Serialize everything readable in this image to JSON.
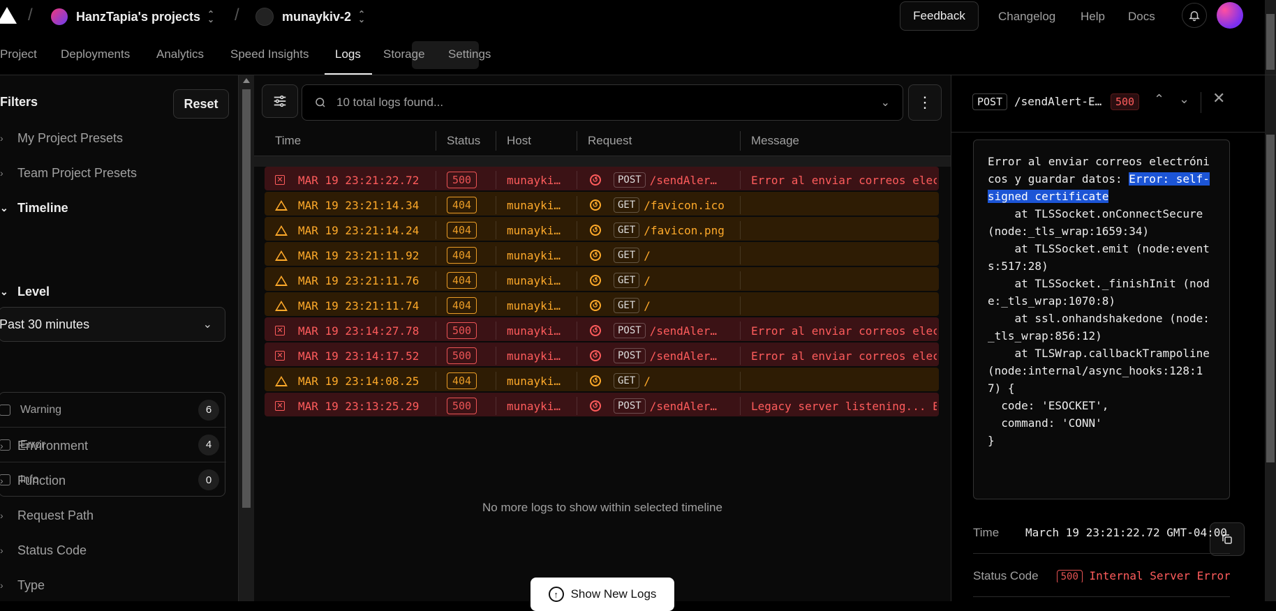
{
  "topbar": {
    "team": "HanzTapia's projects",
    "project": "munaykiv-2",
    "feedback": "Feedback",
    "changelog": "Changelog",
    "help": "Help",
    "docs": "Docs"
  },
  "tabs": [
    "Project",
    "Deployments",
    "Analytics",
    "Speed Insights",
    "Logs",
    "Storage",
    "Settings"
  ],
  "sidebar": {
    "title": "Filters",
    "reset": "Reset",
    "my_presets": "My Project Presets",
    "team_presets": "Team Project Presets",
    "timeline": "Timeline",
    "timeline_value": "Past 30 minutes",
    "level": "Level",
    "levels": [
      {
        "label": "Warning",
        "count": "6"
      },
      {
        "label": "Error",
        "count": "4"
      },
      {
        "label": "Info",
        "count": "0"
      }
    ],
    "environment": "Environment",
    "function": "Function",
    "request_path": "Request Path",
    "status_code": "Status Code",
    "type": "Type"
  },
  "search": {
    "placeholder": "10 total logs found..."
  },
  "table": {
    "headers": {
      "time": "Time",
      "status": "Status",
      "host": "Host",
      "request": "Request",
      "message": "Message"
    },
    "rows": [
      {
        "kind": "error",
        "time": "MAR 19 23:21:22.72",
        "status": "500",
        "host": "munayki…",
        "method": "POST",
        "path": "/sendAler…",
        "message": "Error al enviar correos elec"
      },
      {
        "kind": "warning",
        "time": "MAR 19 23:21:14.34",
        "status": "404",
        "host": "munayki…",
        "method": "GET",
        "path": "/favicon.ico",
        "message": ""
      },
      {
        "kind": "warning",
        "time": "MAR 19 23:21:14.24",
        "status": "404",
        "host": "munayki…",
        "method": "GET",
        "path": "/favicon.png",
        "message": ""
      },
      {
        "kind": "warning",
        "time": "MAR 19 23:21:11.92",
        "status": "404",
        "host": "munayki…",
        "method": "GET",
        "path": "/",
        "message": ""
      },
      {
        "kind": "warning",
        "time": "MAR 19 23:21:11.76",
        "status": "404",
        "host": "munayki…",
        "method": "GET",
        "path": "/",
        "message": ""
      },
      {
        "kind": "warning",
        "time": "MAR 19 23:21:11.74",
        "status": "404",
        "host": "munayki…",
        "method": "GET",
        "path": "/",
        "message": ""
      },
      {
        "kind": "error",
        "time": "MAR 19 23:14:27.78",
        "status": "500",
        "host": "munayki…",
        "method": "POST",
        "path": "/sendAler…",
        "message": "Error al enviar correos elec"
      },
      {
        "kind": "error",
        "time": "MAR 19 23:14:17.52",
        "status": "500",
        "host": "munayki…",
        "method": "POST",
        "path": "/sendAler…",
        "message": "Error al enviar correos elec"
      },
      {
        "kind": "warning",
        "time": "MAR 19 23:14:08.25",
        "status": "404",
        "host": "munayki…",
        "method": "GET",
        "path": "/",
        "message": ""
      },
      {
        "kind": "error",
        "time": "MAR 19 23:13:25.29",
        "status": "500",
        "host": "munayki…",
        "method": "POST",
        "path": "/sendAler…",
        "message": "Legacy server listening... E"
      }
    ],
    "empty": "No more logs to show within selected timeline",
    "show_new": "Show New Logs"
  },
  "detail": {
    "method": "POST",
    "path": "/sendAlert-E…",
    "status": "500",
    "message_pre": "Error al enviar correos electrónicos y guardar datos: ",
    "message_highlight": "Error: self-signed certificate",
    "message_post": "\n    at TLSSocket.onConnectSecure (node:_tls_wrap:1659:34)\n    at TLSSocket.emit (node:events:517:28)\n    at TLSSocket._finishInit (node:_tls_wrap:1070:8)\n    at ssl.onhandshakedone (node:_tls_wrap:856:12)\n    at TLSWrap.callbackTrampoline (node:internal/async_hooks:128:17) {\n  code: 'ESOCKET',\n  command: 'CONN'\n}",
    "time_label": "Time",
    "time_value": "March 19 23:21:22.72 GMT-04:00",
    "status_label": "Status Code",
    "status_code": "500",
    "status_text": "Internal Server Error"
  },
  "colors": {
    "error": "#ff5c5c",
    "warning": "#ffaa2a",
    "highlight": "#1c55d6"
  }
}
